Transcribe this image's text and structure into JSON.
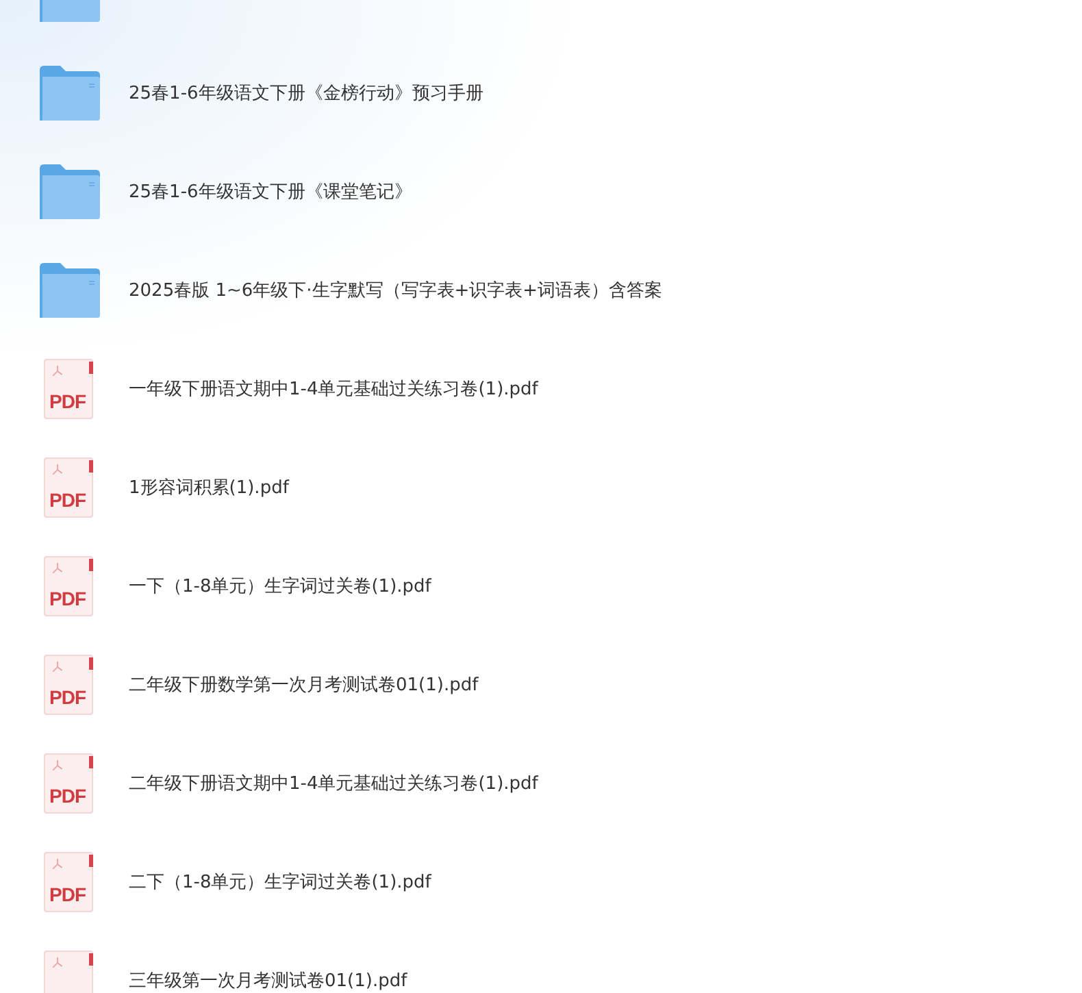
{
  "files": [
    {
      "kind": "folder"
    },
    {
      "kind": "folder",
      "name": "25春1-6年级语文下册《金榜行动》预习手册"
    },
    {
      "kind": "folder",
      "name": "25春1-6年级语文下册《课堂笔记》"
    },
    {
      "kind": "folder",
      "name": "2025春版 1~6年级下·生字默写（写字表+识字表+词语表）含答案"
    },
    {
      "kind": "pdf",
      "badge": "PDF",
      "name": "一年级下册语文期中1-4单元基础过关练习卷(1).pdf"
    },
    {
      "kind": "pdf",
      "badge": "PDF",
      "name": "1形容词积累(1).pdf"
    },
    {
      "kind": "pdf",
      "badge": "PDF",
      "name": "一下（1-8单元）生字词过关卷(1).pdf"
    },
    {
      "kind": "pdf",
      "badge": "PDF",
      "name": "二年级下册数学第一次月考测试卷01(1).pdf"
    },
    {
      "kind": "pdf",
      "badge": "PDF",
      "name": "二年级下册语文期中1-4单元基础过关练习卷(1).pdf"
    },
    {
      "kind": "pdf",
      "badge": "PDF",
      "name": "二下（1-8单元）生字词过关卷(1).pdf"
    },
    {
      "kind": "pdf",
      "name": "三年级第一次月考测试卷01(1).pdf"
    }
  ]
}
